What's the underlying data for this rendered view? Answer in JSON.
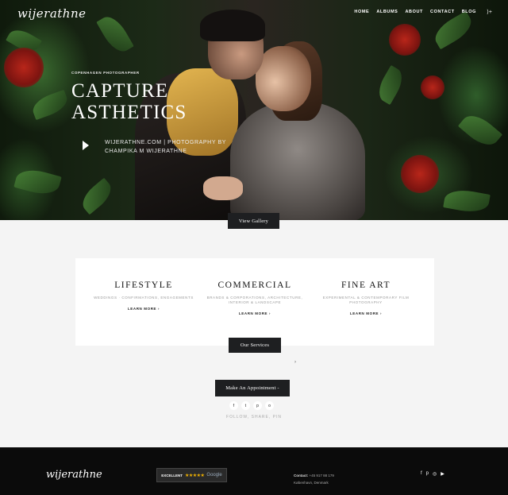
{
  "header": {
    "logo": "wijerathne",
    "nav": [
      "HOME",
      "ALBUMS",
      "ABOUT",
      "CONTACT",
      "BLOG"
    ],
    "nav_extra": "⟩+"
  },
  "hero": {
    "kicker": "COPENHAGEN PHOTOGRAPHER",
    "title_line1": "CAPTURE",
    "title_line2": "ASTHETICS",
    "credit": "WIJERATHNE.COM | PHOTOGRAPHY BY CHAMPIKA M WIJERATHNE",
    "gallery_button": "View Gallery"
  },
  "services": [
    {
      "title": "LIFESTYLE",
      "desc": "WEDDINGS · CONFIRMATIONS, ENGAGEMENTS",
      "more": "LEARN MORE  ›"
    },
    {
      "title": "COMMERCIAL",
      "desc": "BRANDS & CORPORATIONS, ARCHITECTURE, INTERIOR & LANDSCAPE",
      "more": "LEARN MORE  ›"
    },
    {
      "title": "FINE ART",
      "desc": "EXPERIMENTAL & CONTEMPORARY FILM PHOTOGRAPHY",
      "more": "LEARN MORE  ›"
    }
  ],
  "services_button": "Our Services",
  "appointment_button": "Make An Appointment -",
  "social_icons": [
    "f",
    "t",
    "p",
    "o"
  ],
  "follow_text": "FOLLOW, SHARE, PIN",
  "footer": {
    "logo": "wijerathne",
    "badge_label": "EXCELLENT",
    "badge_stars": "★★★★★",
    "badge_brand": "Google",
    "contact_label": "Contact:",
    "contact_phone": "+45 917 88 179",
    "contact_city": "København, Denmark",
    "social_icons": [
      "f",
      "p",
      "◎",
      "▶"
    ]
  }
}
